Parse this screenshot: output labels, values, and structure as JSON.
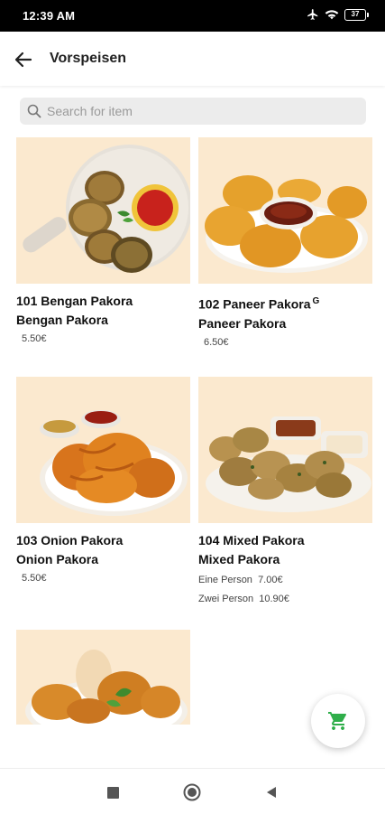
{
  "status_bar": {
    "time": "12:39 AM",
    "battery": "37"
  },
  "app_bar": {
    "title": "Vorspeisen",
    "back_icon": "arrow-left-icon"
  },
  "search": {
    "placeholder": "Search for item",
    "value": ""
  },
  "items": [
    {
      "title": "101 Bengan Pakora",
      "subtitle": "Bengan Pakora",
      "price": "5.50€",
      "image": "bengan-pakora-image"
    },
    {
      "title": "102 Paneer Pakora",
      "superscript": "G",
      "subtitle": "Paneer Pakora",
      "price": "6.50€",
      "image": "paneer-pakora-image"
    },
    {
      "title": "103 Onion Pakora",
      "subtitle": "Onion Pakora",
      "price": "5.50€",
      "image": "onion-pakora-image"
    },
    {
      "title": "104 Mixed Pakora",
      "subtitle": "Mixed Pakora",
      "prices": [
        {
          "label": "Eine Person",
          "price": "7.00€"
        },
        {
          "label": "Zwei Person",
          "price": "10.90€"
        }
      ],
      "image": "mixed-pakora-image"
    },
    {
      "image": "chicken-pakora-image"
    }
  ],
  "colors": {
    "accent": "#2fae4a",
    "card_bg": "#fbe9cf"
  },
  "cart_icon": "shopping-cart-icon",
  "nav": {
    "recents_icon": "square-icon",
    "home_icon": "circle-icon",
    "back_icon": "triangle-back-icon"
  }
}
